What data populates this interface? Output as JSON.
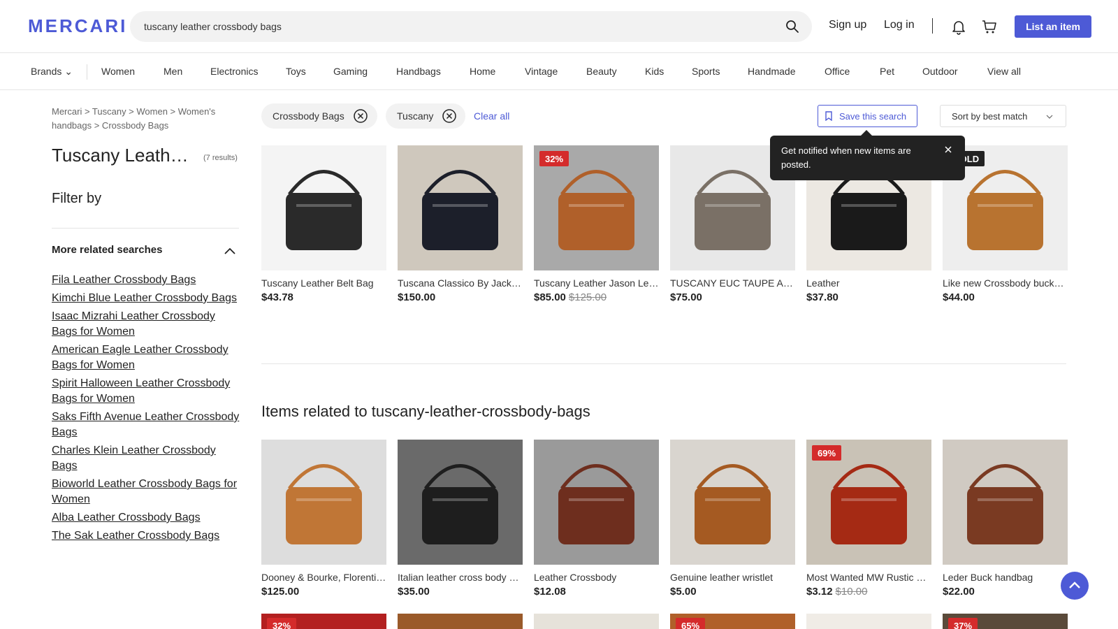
{
  "header": {
    "logo": "MERCARI",
    "search_value": "tuscany leather crossbody bags",
    "icons": [
      "search-icon",
      "bell-icon",
      "cart-icon"
    ],
    "sign_up": "Sign up",
    "log_in": "Log in",
    "list_item": "List an item",
    "accent_color": "#4d5ad6"
  },
  "categories": [
    "Brands",
    "Women",
    "Men",
    "Electronics",
    "Toys",
    "Gaming",
    "Handbags",
    "Home",
    "Vintage",
    "Beauty",
    "Kids",
    "Sports",
    "Handmade",
    "Office",
    "Pet",
    "Outdoor",
    "View all"
  ],
  "breadcrumb": "Mercari > Tuscany > Women > Women's handbags > Crossbody Bags",
  "page": {
    "title": "Tuscany Leather Crossbody Bags",
    "results": "(7 results)",
    "filter_by": "Filter by"
  },
  "related_searches": {
    "title": "More related searches",
    "items": [
      "Fila Leather Crossbody Bags",
      "Kimchi Blue Leather Crossbody Bags",
      "Isaac Mizrahi Leather Crossbody Bags for Women",
      "American Eagle Leather Crossbody Bags for Women",
      "Spirit Halloween Leather Crossbody Bags for Women",
      "Saks Fifth Avenue Leather Crossbody Bags",
      "Charles Klein Leather Crossbody Bags",
      "Bioworld Leather Crossbody Bags for Women",
      "Alba Leather Crossbody Bags",
      "The Sak Leather Crossbody Bags"
    ]
  },
  "chips": [
    "Crossbody Bags",
    "Tuscany"
  ],
  "clear_all": "Clear all",
  "save_search": "Save this search",
  "sort": "Sort by best match",
  "tooltip": "Get notified when new items are posted.",
  "results_items": [
    {
      "title": "Tuscany Leather Belt Bag",
      "price": "$43.78",
      "old_price": "",
      "badge": "",
      "color": "#2a2a2a",
      "bg": "#f4f4f4"
    },
    {
      "title": "Tuscana Classico By Jack Georges Leather Crossbody",
      "price": "$150.00",
      "old_price": "",
      "badge": "",
      "color": "#1c1f2a",
      "bg": "#cfc8bd"
    },
    {
      "title": "Tuscany Leather Jason Leather Crossbody",
      "price": "$85.00",
      "old_price": "$125.00",
      "badge": "32%",
      "color": "#b0602a",
      "bg": "#a9a9a9"
    },
    {
      "title": "TUSCANY EUC TAUPE ALL LEATHER SLING",
      "price": "$75.00",
      "old_price": "",
      "badge": "",
      "color": "#7a7066",
      "bg": "#e8e8e8"
    },
    {
      "title": "Leather",
      "price": "$37.80",
      "old_price": "",
      "badge": "",
      "color": "#1a1a1a",
      "bg": "#ece8e2"
    },
    {
      "title": "Like new Crossbody bucket bag",
      "price": "$44.00",
      "old_price": "",
      "badge": "SOLD",
      "color": "#b87330",
      "bg": "#eee"
    }
  ],
  "related_section_title": "Items related to tuscany-leather-crossbody-bags",
  "related_items": [
    {
      "title": "Dooney & Bourke, Florentine leather crossbody",
      "price": "$125.00",
      "old_price": "",
      "badge": "",
      "color": "#c07636",
      "bg": "#ddd"
    },
    {
      "title": "Italian leather cross body bag",
      "price": "$35.00",
      "old_price": "",
      "badge": "",
      "color": "#1e1e1e",
      "bg": "#6a6a6a"
    },
    {
      "title": "Leather Crossbody",
      "price": "$12.08",
      "old_price": "",
      "badge": "",
      "color": "#6e2e1e",
      "bg": "#9a9a9a"
    },
    {
      "title": "Genuine leather wristlet",
      "price": "$5.00",
      "old_price": "",
      "badge": "",
      "color": "#a55a22",
      "bg": "#d9d5cf"
    },
    {
      "title": "Most Wanted MW Rustic Leather Crossbody",
      "price": "$3.12",
      "old_price": "$10.00",
      "badge": "69%",
      "color": "#a52a14",
      "bg": "#c9c2b6"
    },
    {
      "title": "Leder Buck handbag",
      "price": "$22.00",
      "old_price": "",
      "badge": "",
      "color": "#7a3a22",
      "bg": "#d0cac2"
    }
  ],
  "next_row_badges": [
    "32%",
    "",
    "",
    "65%",
    "",
    "37%"
  ]
}
